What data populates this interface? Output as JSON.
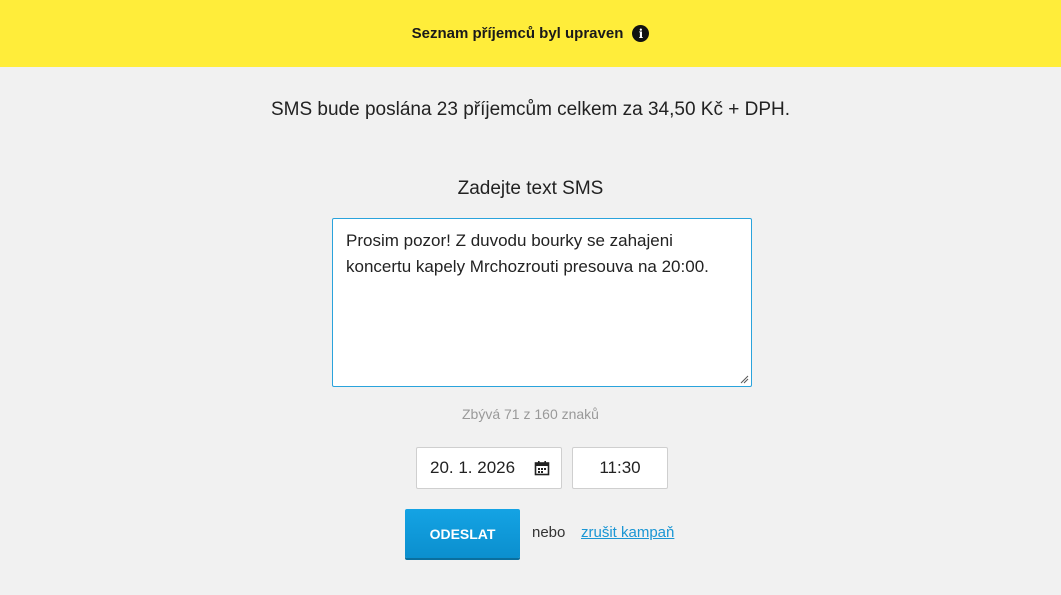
{
  "banner": {
    "message": "Seznam příjemců byl upraven",
    "icon": "info-icon",
    "icon_glyph": "i",
    "color": "#ffed3a"
  },
  "summary": "SMS bude poslána 23 příjemcům celkem za 34,50 Kč + DPH.",
  "form": {
    "prompt": "Zadejte text SMS",
    "sms_text": "Prosim pozor! Z duvodu bourky se zahajeni koncertu kapely Mrchozrouti presouva na 20:00.",
    "counter": "Zbývá 71 z 160 znaků",
    "date_value": "20. 1. 2026",
    "date_icon": "calendar-icon",
    "time_value": "11:30",
    "send_label": "ODESLAT",
    "or_label": "nebo",
    "cancel_label": "zrušit kampaň",
    "accent_color": "#14a3e4",
    "link_color": "#1a96d4"
  }
}
